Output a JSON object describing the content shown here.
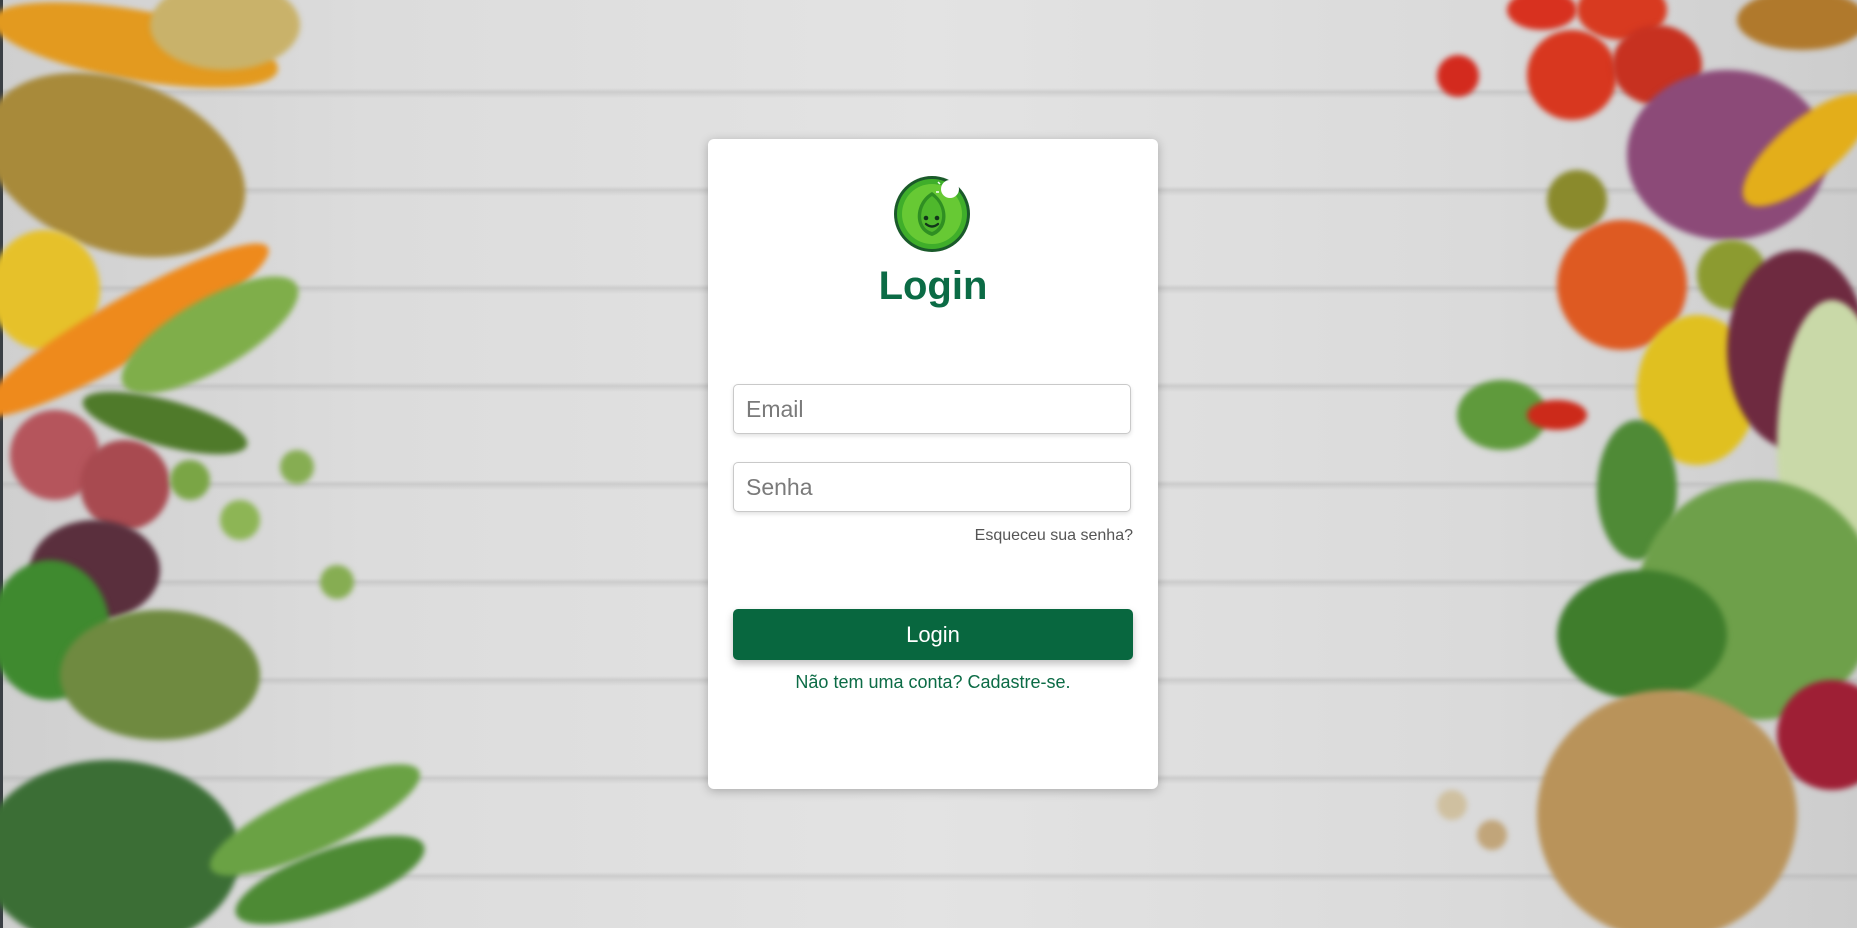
{
  "login_card": {
    "logo_icon": "leaf-smile-logo-icon",
    "title": "Login",
    "email_placeholder": "Email",
    "password_placeholder": "Senha",
    "forgot_password": "Esqueceu sua senha?",
    "login_button": "Login",
    "signup_link": "Não tem uma conta? Cadastre-se."
  },
  "colors": {
    "primary_green": "#08673f",
    "title_green": "#0b6b45",
    "card_bg": "#ffffff"
  }
}
